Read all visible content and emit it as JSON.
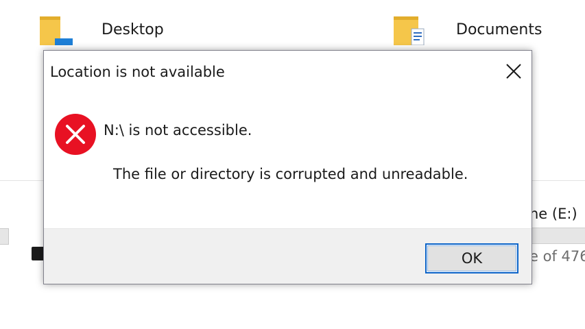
{
  "explorer": {
    "folders": [
      {
        "label": "Desktop",
        "icon": "folder-icon"
      },
      {
        "label": "Documents",
        "icon": "documents-folder-icon"
      }
    ],
    "drive_e": {
      "label_fragment": "ne (E:)",
      "free_space_fragment": "e of 476"
    }
  },
  "dialog": {
    "title": "Location is not available",
    "close_icon": "close-icon",
    "error_icon": "error-icon",
    "message_main": "N:\\ is not accessible.",
    "message_detail": "The file or directory is corrupted and unreadable.",
    "ok_label": "OK"
  },
  "colors": {
    "error_red": "#e81123",
    "focus_blue": "#0a63c8",
    "footer_gray": "#f0f0f0",
    "folder_yellow": "#f5c64a"
  }
}
